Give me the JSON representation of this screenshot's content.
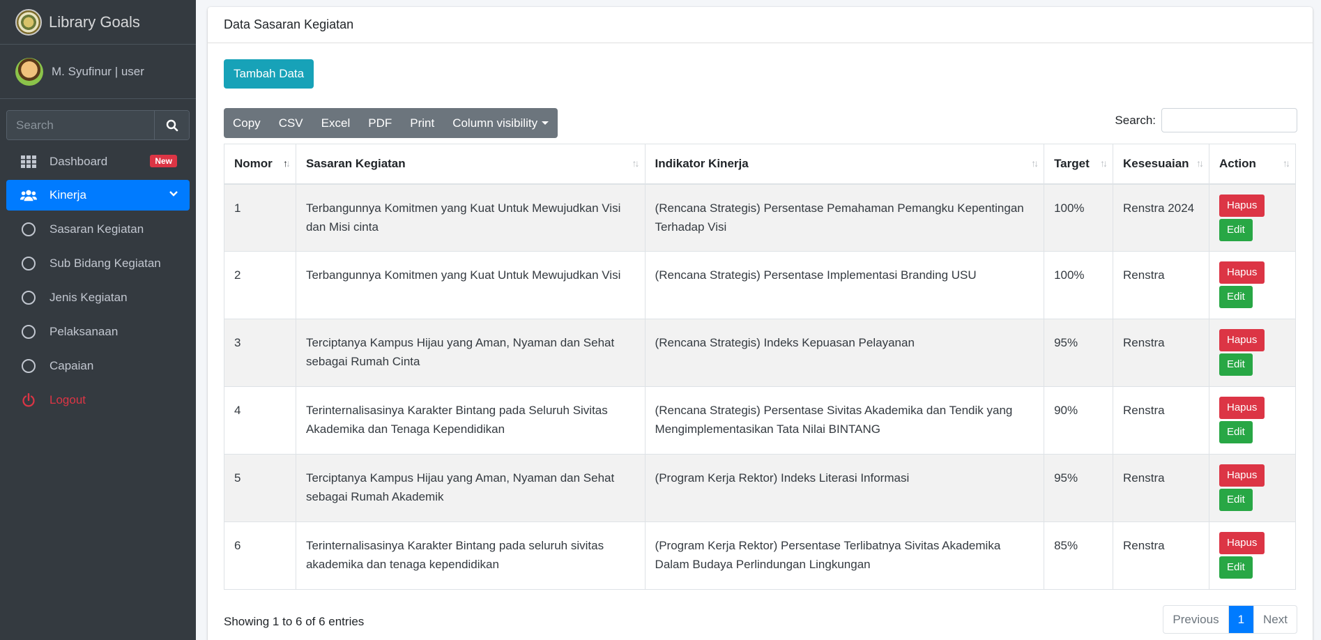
{
  "brand": {
    "title": "Library Goals"
  },
  "user": {
    "name": "M. Syufinur | user"
  },
  "sidebar_search": {
    "placeholder": "Search"
  },
  "nav": {
    "dashboard": "Dashboard",
    "new_badge": "New",
    "kinerja": "Kinerja",
    "sasaran": "Sasaran Kegiatan",
    "sub_bidang": "Sub Bidang Kegiatan",
    "jenis": "Jenis Kegiatan",
    "pelaksanaan": "Pelaksanaan",
    "capaian": "Capaian",
    "logout": "Logout"
  },
  "card": {
    "title": "Data Sasaran Kegiatan",
    "add_button": "Tambah Data"
  },
  "toolbar": {
    "copy": "Copy",
    "csv": "CSV",
    "excel": "Excel",
    "pdf": "PDF",
    "print": "Print",
    "column_visibility": "Column visibility"
  },
  "search": {
    "label": "Search:"
  },
  "table": {
    "headers": [
      "Nomor",
      "Sasaran Kegiatan",
      "Indikator Kinerja",
      "Target",
      "Kesesuaian",
      "Action"
    ],
    "rows": [
      {
        "no": "1",
        "sasaran": "Terbangunnya Komitmen yang Kuat Untuk Mewujudkan Visi dan Misi cinta",
        "indikator": "(Rencana Strategis) Persentase Pemahaman Pemangku Kepentingan Terhadap Visi",
        "target": "100%",
        "kesesuaian": "Renstra 2024"
      },
      {
        "no": "2",
        "sasaran": "Terbangunnya Komitmen yang Kuat Untuk Mewujudkan Visi",
        "indikator": "(Rencana Strategis) Persentase Implementasi Branding USU",
        "target": "100%",
        "kesesuaian": "Renstra"
      },
      {
        "no": "3",
        "sasaran": "Terciptanya Kampus Hijau yang Aman, Nyaman dan Sehat sebagai Rumah Cinta",
        "indikator": "(Rencana Strategis) Indeks Kepuasan Pelayanan",
        "target": "95%",
        "kesesuaian": "Renstra"
      },
      {
        "no": "4",
        "sasaran": "Terinternalisasinya Karakter Bintang pada Seluruh Sivitas Akademika dan Tenaga Kependidikan",
        "indikator": "(Rencana Strategis) Persentase Sivitas Akademika dan Tendik yang Mengimplementasikan Tata Nilai BINTANG",
        "target": "90%",
        "kesesuaian": "Renstra"
      },
      {
        "no": "5",
        "sasaran": "Terciptanya Kampus Hijau yang Aman, Nyaman dan Sehat sebagai Rumah Akademik",
        "indikator": "(Program Kerja Rektor) Indeks Literasi Informasi",
        "target": "95%",
        "kesesuaian": "Renstra"
      },
      {
        "no": "6",
        "sasaran": "Terinternalisasinya Karakter Bintang pada seluruh sivitas akademika dan tenaga kependidikan",
        "indikator": "(Program Kerja Rektor) Persentase Terlibatnya Sivitas Akademika Dalam Budaya Perlindungan Lingkungan",
        "target": "85%",
        "kesesuaian": "Renstra"
      }
    ],
    "action_delete": "Hapus",
    "action_edit": "Edit"
  },
  "footer": {
    "info": "Showing 1 to 6 of 6 entries",
    "previous": "Previous",
    "page": "1",
    "next": "Next"
  },
  "colors": {
    "sidebar_bg": "#343a40",
    "active": "#007bff",
    "danger": "#dc3545",
    "success": "#28a745",
    "info": "#17a2b8",
    "secondary": "#6c757d"
  }
}
